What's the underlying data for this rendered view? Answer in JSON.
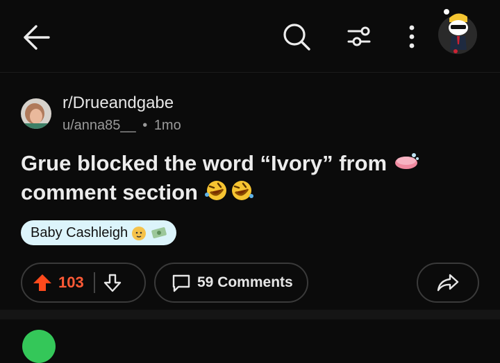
{
  "header": {
    "back_icon": "back-arrow-icon",
    "search_icon": "search-icon",
    "filter_icon": "filter-icon",
    "more_icon": "more-vertical-icon"
  },
  "post": {
    "subreddit": "r/Drueandgabe",
    "author": "u/anna85__",
    "dot": "•",
    "age": "1mo",
    "title_line1": "Grue blocked the word “Ivory” from",
    "title_line2": "comment section",
    "flair": "Baby Cashleigh",
    "votes": "103",
    "comments_label": "59 Comments"
  },
  "colors": {
    "background": "#0b0b0b",
    "upvote": "#ff5a36",
    "flair_bg": "#dcf4fb",
    "next_avatar": "#34c759"
  }
}
